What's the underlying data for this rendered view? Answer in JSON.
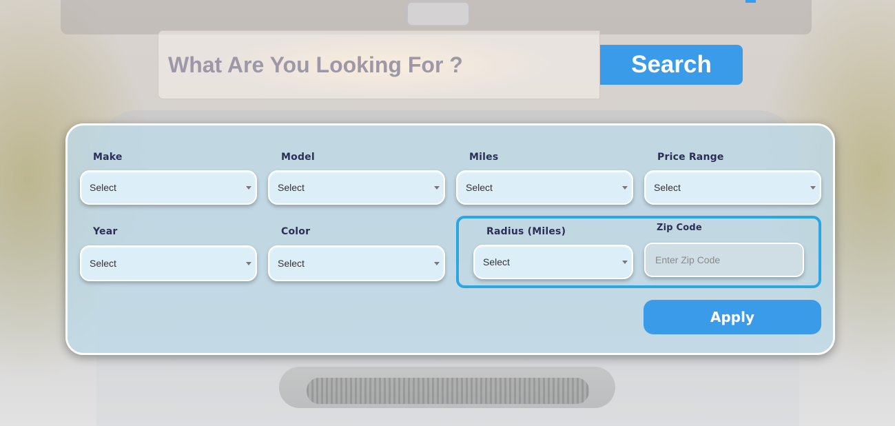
{
  "search": {
    "placeholder": "What Are You Looking For ?",
    "button_label": "Search"
  },
  "filters": {
    "make": {
      "label": "Make",
      "value": "Select"
    },
    "model": {
      "label": "Model",
      "value": "Select"
    },
    "miles": {
      "label": "Miles",
      "value": "Select"
    },
    "price_range": {
      "label": "Price Range",
      "value": "Select"
    },
    "year": {
      "label": "Year",
      "value": "Select"
    },
    "color": {
      "label": "Color",
      "value": "Select"
    },
    "radius": {
      "label": "Radius (Miles)",
      "value": "Select"
    },
    "zip_code": {
      "label": "Zip Code",
      "placeholder": "Enter Zip Code"
    }
  },
  "apply_label": "Apply",
  "colors": {
    "accent": "#3a9be8",
    "radius_group_border": "#2aa7e0",
    "label_text": "#2c2f55"
  }
}
